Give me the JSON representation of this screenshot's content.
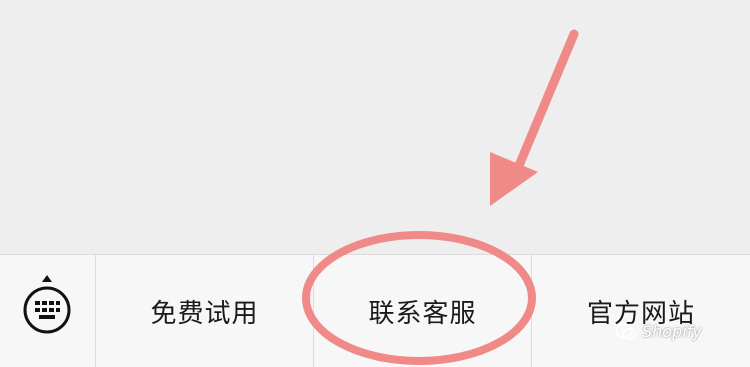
{
  "menu": {
    "items": [
      {
        "label": "免费试用"
      },
      {
        "label": "联系客服"
      },
      {
        "label": "官方网站"
      }
    ]
  },
  "icons": {
    "keyboard": "keyboard-icon",
    "caret": "caret-up-icon",
    "wechat": "wechat-icon"
  },
  "watermark": {
    "text": "Shopify"
  },
  "colors": {
    "background": "#efeeee",
    "menu_bg": "#f7f7f7",
    "annotation": "#f08a88"
  }
}
